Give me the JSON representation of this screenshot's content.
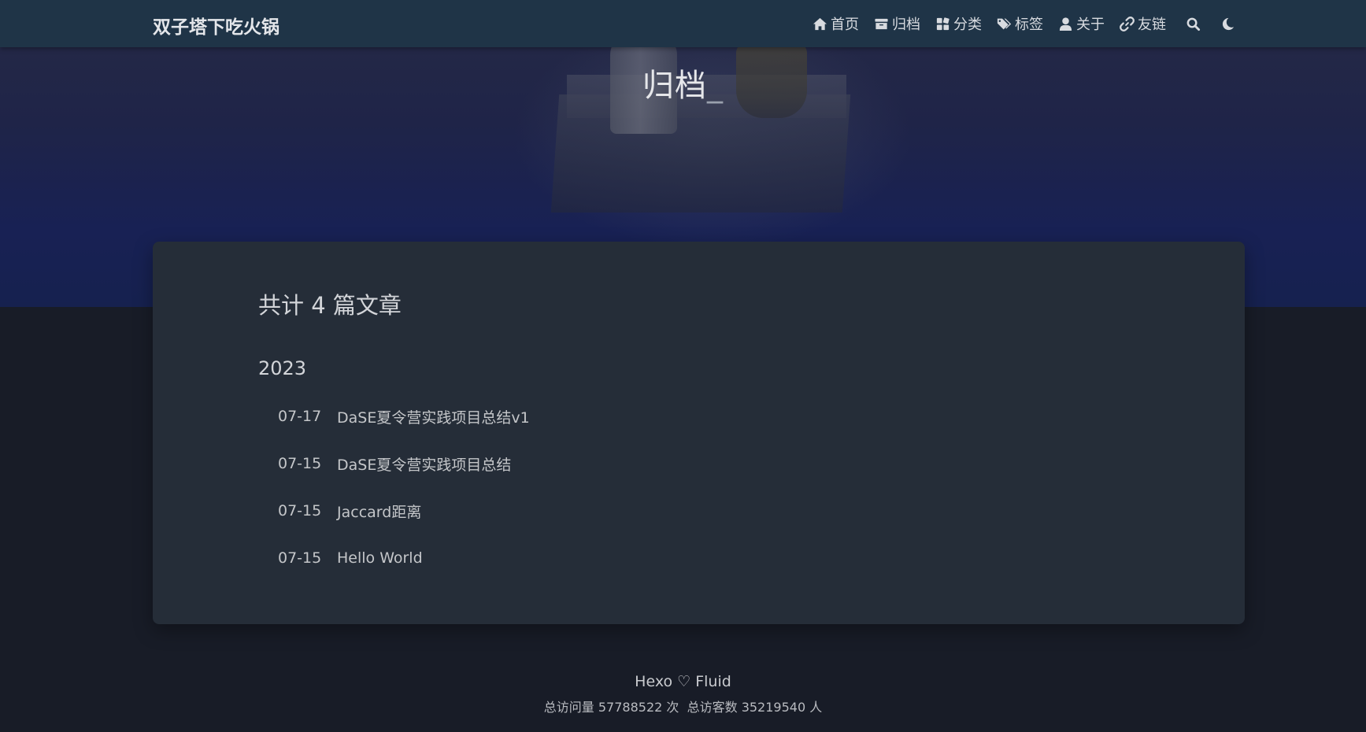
{
  "navbar": {
    "brand": "双子塔下吃火锅",
    "items": [
      {
        "label": "首页",
        "icon": "home-icon"
      },
      {
        "label": "归档",
        "icon": "archive-icon"
      },
      {
        "label": "分类",
        "icon": "category-icon"
      },
      {
        "label": "标签",
        "icon": "tags-icon"
      },
      {
        "label": "关于",
        "icon": "user-icon"
      },
      {
        "label": "友链",
        "icon": "link-icon"
      }
    ],
    "search_icon": "search-icon",
    "theme_icon": "moon-icon"
  },
  "hero": {
    "title": "归档",
    "cursor": "_"
  },
  "archive": {
    "total_text": "共计 4 篇文章",
    "year": "2023",
    "posts": [
      {
        "date": "07-17",
        "title": "DaSE夏令营实践项目总结v1"
      },
      {
        "date": "07-15",
        "title": "DaSE夏令营实践项目总结"
      },
      {
        "date": "07-15",
        "title": "Jaccard距离"
      },
      {
        "date": "07-15",
        "title": "Hello World"
      }
    ]
  },
  "footer": {
    "powered": "Hexo ♡ Fluid",
    "pv_prefix": "总访问量",
    "pv_count": "57788522",
    "pv_suffix": "次",
    "uv_prefix": "总访客数",
    "uv_count": "35219540",
    "uv_suffix": "人"
  },
  "colors": {
    "navbar_bg": "#1f3447",
    "page_bg": "#181c27",
    "card_bg": "#252d38",
    "text": "#c4c6c9"
  }
}
